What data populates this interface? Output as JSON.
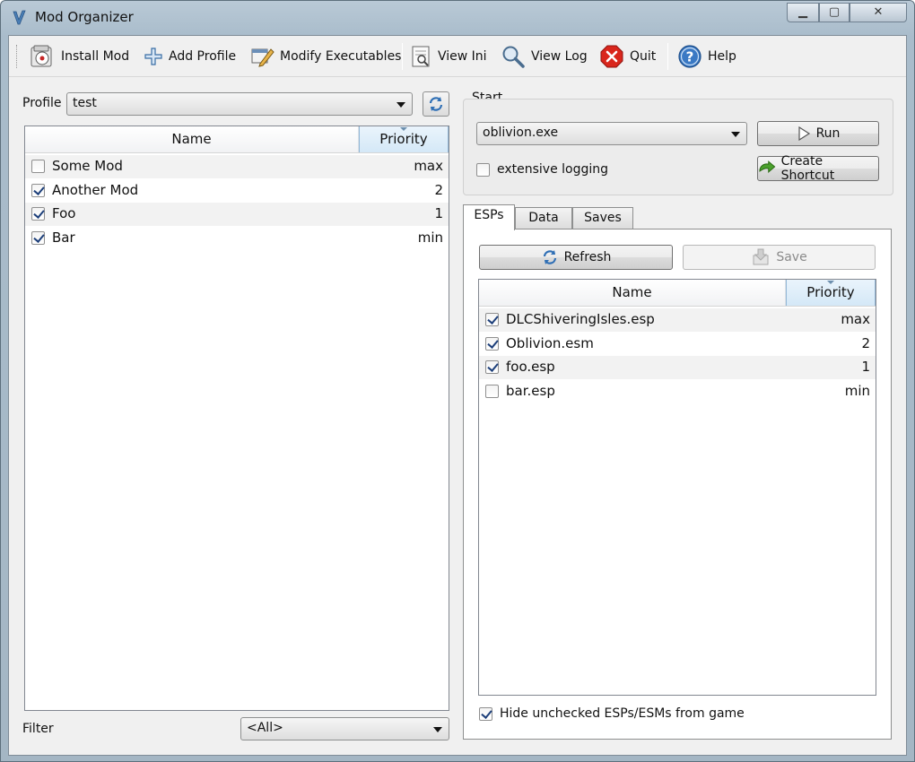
{
  "window": {
    "title": "Mod Organizer",
    "controls": {
      "minimize": "▁",
      "maximize": "▢",
      "close": "✕"
    }
  },
  "toolbar": {
    "items": [
      {
        "label": "Install Mod",
        "icon": "install-mod-icon"
      },
      {
        "label": "Add Profile",
        "icon": "add-profile-icon"
      },
      {
        "label": "Modify Executables",
        "icon": "modify-executables-icon"
      },
      {
        "label": "View Ini",
        "icon": "view-ini-icon"
      },
      {
        "label": "View Log",
        "icon": "view-log-icon"
      },
      {
        "label": "Quit",
        "icon": "quit-icon"
      },
      {
        "label": "Help",
        "icon": "help-icon"
      }
    ]
  },
  "profile": {
    "label": "Profile",
    "selected": "test"
  },
  "mods": {
    "columns": {
      "name": "Name",
      "priority": "Priority"
    },
    "rows": [
      {
        "name": "Some Mod",
        "priority": "max",
        "checked": false
      },
      {
        "name": "Another Mod",
        "priority": "2",
        "checked": true
      },
      {
        "name": "Foo",
        "priority": "1",
        "checked": true
      },
      {
        "name": "Bar",
        "priority": "min",
        "checked": true
      }
    ]
  },
  "filter": {
    "label": "Filter",
    "selected": "<All>"
  },
  "start": {
    "group_label": "Start",
    "executable": "oblivion.exe",
    "run_label": "Run",
    "logging_label": "extensive logging",
    "logging_checked": false,
    "shortcut_label": "Create Shortcut"
  },
  "tabs": [
    {
      "label": "ESPs",
      "active": true
    },
    {
      "label": "Data",
      "active": false
    },
    {
      "label": "Saves",
      "active": false
    }
  ],
  "esps": {
    "refresh_label": "Refresh",
    "save_label": "Save",
    "columns": {
      "name": "Name",
      "priority": "Priority"
    },
    "rows": [
      {
        "name": "DLCShiveringIsles.esp",
        "priority": "max",
        "checked": true
      },
      {
        "name": "Oblivion.esm",
        "priority": "2",
        "checked": true
      },
      {
        "name": "foo.esp",
        "priority": "1",
        "checked": true
      },
      {
        "name": "bar.esp",
        "priority": "min",
        "checked": false
      }
    ],
    "hide_label": "Hide unchecked ESPs/ESMs from game",
    "hide_checked": true
  },
  "colors": {
    "accent": "#3a79c4",
    "quit_red": "#d9261c",
    "sorted_header": "#d4e8f7"
  }
}
